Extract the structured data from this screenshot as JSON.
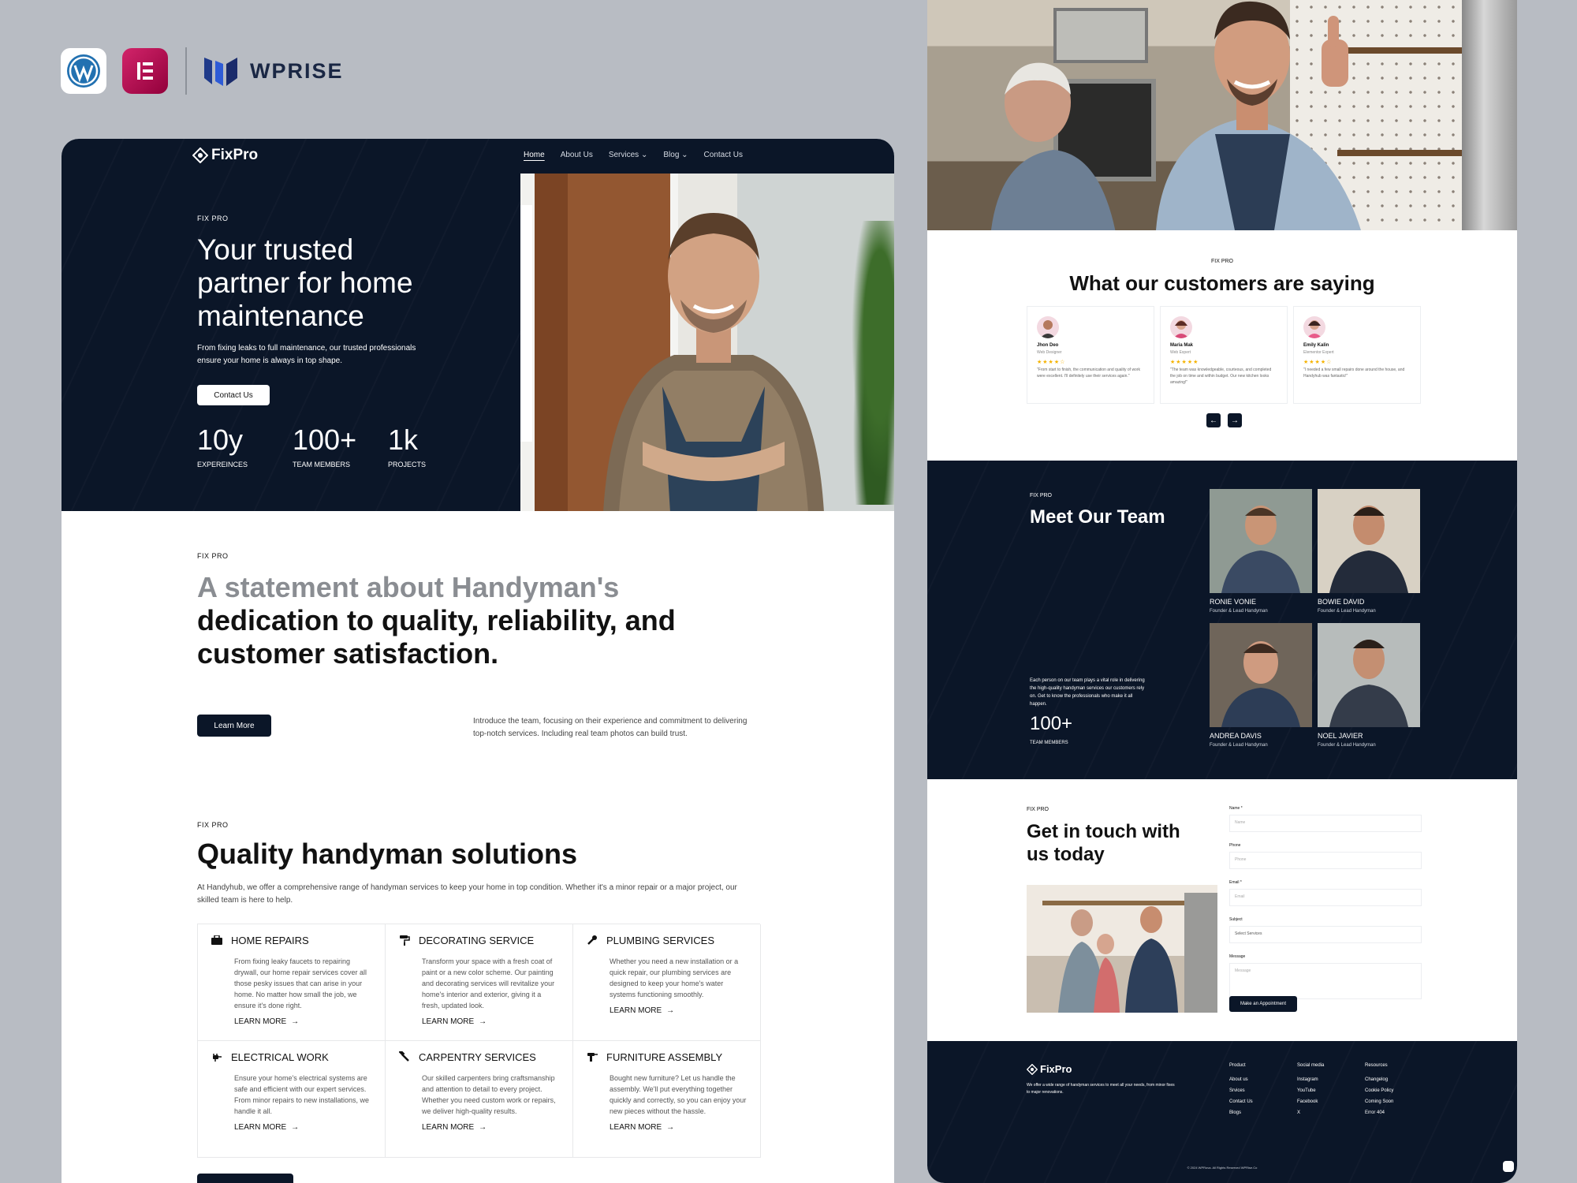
{
  "brands": {
    "wordpress_icon": "wordpress-icon",
    "elementor_icon": "elementor-icon",
    "wprise_text": "WPRISE"
  },
  "site": {
    "logo": "FixPro",
    "nav": [
      "Home",
      "About Us",
      "Services",
      "Blog",
      "Contact Us"
    ],
    "hero": {
      "eyebrow": "FIX PRO",
      "title": "Your trusted partner for home maintenance",
      "subtitle": "From fixing leaks to full maintenance, our trusted professionals ensure your home is always in top shape.",
      "cta": "Contact Us",
      "stats": [
        {
          "value": "10y",
          "label": "EXPEREINCES"
        },
        {
          "value": "100+",
          "label": "TEAM MEMBERS"
        },
        {
          "value": "1k",
          "label": "PROJECTS"
        }
      ]
    },
    "statement": {
      "eyebrow": "FIX PRO",
      "muted": "A statement about Handyman's",
      "main": "dedication to quality, reliability, and customer satisfaction.",
      "button": "Learn More",
      "text": "Introduce the team, focusing on their experience and commitment to delivering top-notch services. Including real team photos can build trust."
    },
    "services": {
      "eyebrow": "FIX PRO",
      "title": "Quality handyman solutions",
      "subtitle": "At Handyhub, we offer a comprehensive range of handyman services to keep your home in top condition. Whether it's a minor repair or a major project, our skilled team is here to help.",
      "link_label": "LEARN MORE",
      "items": [
        {
          "title": "HOME REPAIRS",
          "icon": "toolbox-icon",
          "desc": "From fixing leaky faucets to repairing drywall, our home repair services cover all those pesky issues that can arise in your home. No matter how small the job, we ensure it's done right."
        },
        {
          "title": "DECORATING SERVICE",
          "icon": "paint-roller-icon",
          "desc": "Transform your space with a fresh coat of paint or a new color scheme. Our painting and decorating services will revitalize your home's interior and exterior, giving it a fresh, updated look."
        },
        {
          "title": "PLUMBING SERVICES",
          "icon": "wrench-icon",
          "desc": "Whether you need a new installation or a quick repair, our plumbing services are designed to keep your home's water systems functioning smoothly."
        },
        {
          "title": "ELECTRICAL WORK",
          "icon": "plug-icon",
          "desc": "Ensure your home's electrical systems are safe and efficient with our expert services. From minor repairs to new installations, we handle it all."
        },
        {
          "title": "CARPENTRY SERVICES",
          "icon": "hammer-icon",
          "desc": "Our skilled carpenters bring craftsmanship and attention to detail to every project. Whether you need custom work or repairs, we deliver high-quality results."
        },
        {
          "title": "FURNITURE ASSEMBLY",
          "icon": "drill-icon",
          "desc": "Bought new furniture? Let us handle the assembly. We'll put everything together quickly and correctly, so you can enjoy your new pieces without the hassle."
        }
      ]
    }
  },
  "testimonials": {
    "eyebrow": "FIX PRO",
    "title": "What our customers are saying",
    "items": [
      {
        "name": "Jhon Deo",
        "role": "Web Designer",
        "stars": "★★★★☆",
        "quote": "\"From start to finish, the communication and quality of work were excellent. I'll definitely use their services again.\""
      },
      {
        "name": "Maria Mak",
        "role": "Web Expert",
        "stars": "★★★★★",
        "quote": "\"The team was knowledgeable, courteous, and completed the job on time and within budget. Our new kitchen looks amazing!\""
      },
      {
        "name": "Emily Kalin",
        "role": "Elementor Expert",
        "stars": "★★★★☆",
        "quote": "\"I needed a few small repairs done around the house, and Handyhub was fantastic!\""
      }
    ],
    "prev": "←",
    "next": "→"
  },
  "team": {
    "eyebrow": "FIX PRO",
    "title": "Meet Our Team",
    "text": "Each person on our team plays a vital role in delivering the high-quality handyman services our customers rely on. Get to know the professionals who make it all happen.",
    "count": "100+",
    "count_label": "TEAM MEMBERS",
    "members": [
      {
        "name": "RONIE VONIE",
        "role": "Founder & Lead Handyman"
      },
      {
        "name": "BOWIE DAVID",
        "role": "Founder & Lead Handyman"
      },
      {
        "name": "ANDREA DAVIS",
        "role": "Founder & Lead Handyman"
      },
      {
        "name": "NOEL JAVIER",
        "role": "Founder & Lead Handyman"
      }
    ]
  },
  "contact": {
    "eyebrow": "FIX PRO",
    "title": "Get in touch with us today",
    "fields": [
      {
        "label": "Name *",
        "placeholder": "Name"
      },
      {
        "label": "Phone",
        "placeholder": "Phone"
      },
      {
        "label": "Email *",
        "placeholder": "Email"
      },
      {
        "label": "Subject",
        "placeholder": "Select Services"
      },
      {
        "label": "Message",
        "placeholder": "Message"
      }
    ],
    "button": "Make an Appointment"
  },
  "footer": {
    "logo": "FixPro",
    "desc": "We offer a wide range of handyman services to meet all your needs, from minor fixes to major renovations.",
    "columns": [
      {
        "head": "Product",
        "items": [
          "About us",
          "Srvices",
          "Contact Us",
          "Blogs"
        ]
      },
      {
        "head": "Social media",
        "items": [
          "Instagram",
          "YouTube",
          "Facebook",
          "X"
        ]
      },
      {
        "head": "Resources",
        "items": [
          "Changelog",
          "Cookie Policy",
          "Coming Soon",
          "Error 404"
        ]
      }
    ],
    "copyright": "© 2024 WPRova. All Rights Reserved WPRise.Co"
  },
  "colors": {
    "navy": "#0b1628",
    "background": "#b8bcc3",
    "star": "#f5b301"
  }
}
